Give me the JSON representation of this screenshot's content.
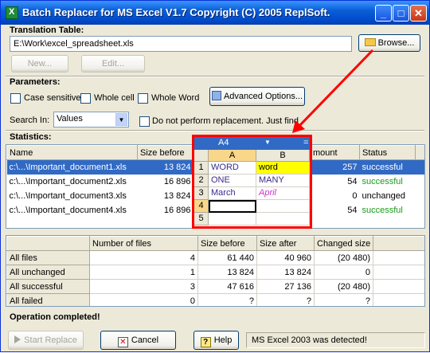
{
  "window": {
    "title": "Batch Replacer for MS Excel V1.7 Copyright (C) 2005 ReplSoft."
  },
  "translation": {
    "label": "Translation Table:",
    "path": "E:\\Work\\excel_spreadsheet.xls",
    "browse": "Browse...",
    "new": "New...",
    "edit": "Edit..."
  },
  "parameters": {
    "label": "Parameters:",
    "case_sensitive": "Case sensitive",
    "whole_cell": "Whole cell",
    "whole_word": "Whole Word",
    "advanced": "Advanced Options...",
    "search_in_label": "Search In:",
    "search_in_value": "Values",
    "no_replace": "Do not perform replacement. Just find"
  },
  "statistics": {
    "label": "Statistics:",
    "columns": {
      "name": "Name",
      "size_before": "Size before",
      "amount": "mount",
      "status": "Status"
    },
    "rows": [
      {
        "name": "c:\\...\\Important_document1.xls",
        "size": "13 824",
        "amount": "257",
        "status": "successful"
      },
      {
        "name": "c:\\...\\Important_document2.xls",
        "size": "16 896",
        "amount": "54",
        "status": "successful"
      },
      {
        "name": "c:\\...\\Important_document3.xls",
        "size": "13 824",
        "amount": "0",
        "status": "unchanged"
      },
      {
        "name": "c:\\...\\Important_document4.xls",
        "size": "16 896",
        "amount": "54",
        "status": "successful"
      }
    ]
  },
  "summary": {
    "columns": [
      "Number of files",
      "Size before",
      "Size after",
      "Changed size"
    ],
    "rows": [
      {
        "label": "All files",
        "files": "4",
        "before": "61 440",
        "after": "40 960",
        "changed": "(20 480)"
      },
      {
        "label": "All unchanged",
        "files": "1",
        "before": "13 824",
        "after": "13 824",
        "changed": "0"
      },
      {
        "label": "All successful",
        "files": "3",
        "before": "47 616",
        "after": "27 136",
        "changed": "(20 480)"
      },
      {
        "label": "All failed",
        "files": "0",
        "before": "?",
        "after": "?",
        "changed": "?"
      }
    ]
  },
  "status": {
    "message": "Operation completed!",
    "start": "Start Replace",
    "cancel": "Cancel",
    "help": "Help",
    "detected": "MS Excel 2003 was detected!"
  },
  "excel_overlay": {
    "name_box": "A4",
    "fx": "=",
    "col_a": "A",
    "col_b": "B",
    "rows": [
      {
        "n": "1",
        "a": "WORD",
        "b": "word"
      },
      {
        "n": "2",
        "a": "ONE",
        "b": "MANY"
      },
      {
        "n": "3",
        "a": "March",
        "b": "April"
      },
      {
        "n": "4",
        "a": "",
        "b": ""
      },
      {
        "n": "5",
        "a": "",
        "b": ""
      }
    ]
  },
  "colors": {
    "accent": "#316ac5",
    "highlight_red": "#ff0000",
    "cell_yellow": "#ffff00",
    "april_pink": "#cc33cc",
    "success_green": "#1a9b1a"
  }
}
